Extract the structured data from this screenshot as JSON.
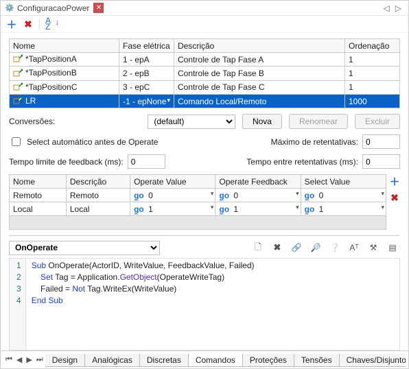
{
  "title": "ConfiguracaoPower",
  "maintable": {
    "cols": [
      "Nome",
      "Fase elétrica",
      "Descrição",
      "Ordenação"
    ],
    "rows": [
      {
        "name": "*TapPositionA",
        "fase": "1 - epA",
        "desc": "Controle de Tap Fase A",
        "ord": "1",
        "sel": false
      },
      {
        "name": "*TapPositionB",
        "fase": "2 - epB",
        "desc": "Controle de Tap Fase B",
        "ord": "1",
        "sel": false
      },
      {
        "name": "*TapPositionC",
        "fase": "3 - epC",
        "desc": "Controle de Tap Fase C",
        "ord": "1",
        "sel": false
      },
      {
        "name": "LR",
        "fase": "-1 - epNone",
        "desc": "Comando Local/Remoto",
        "ord": "1000",
        "sel": true
      }
    ]
  },
  "labels": {
    "conversoes": "Conversões:",
    "conv_value": "(default)",
    "nova": "Nova",
    "renomear": "Renomear",
    "excluir": "Excluir",
    "auto_select": "Select automático antes de Operate",
    "max_ret": "Máximo de retentativas:",
    "max_ret_v": "0",
    "feedback": "Tempo limite de feedback (ms):",
    "feedback_v": "0",
    "tempo_ret": "Tempo entre retentativas (ms):",
    "tempo_ret_v": "0"
  },
  "midtable": {
    "cols": [
      "Nome",
      "Descrição",
      "Operate Value",
      "Operate Feedback",
      "Select Value"
    ],
    "rows": [
      {
        "name": "Remoto",
        "desc": "Remoto",
        "op": "0",
        "fb": "0",
        "sv": "0"
      },
      {
        "name": "Local",
        "desc": "Local",
        "op": "1",
        "fb": "1",
        "sv": "1"
      }
    ]
  },
  "script": {
    "event": "OnOperate",
    "code": {
      "l1a": "Sub",
      "l1b": " OnOperate(ActorID, WriteValue, FeedbackValue, Failed)",
      "l2a": "Set",
      "l2b": " Tag = Application.",
      "l2c": "GetObject",
      "l2d": "(OperateWriteTag)",
      "l3a": "    Failed = ",
      "l3b": "Not",
      "l3c": " Tag.WriteEx(WriteValue)",
      "l4a": "End Sub"
    },
    "lines": [
      "1",
      "2",
      "3",
      "4"
    ]
  },
  "tabs": [
    "Design",
    "Analógicas",
    "Discretas",
    "Comandos",
    "Proteções",
    "Tensões",
    "Chaves/Disjuntores"
  ],
  "active_tab": 3,
  "go_prefix": "g̲o"
}
